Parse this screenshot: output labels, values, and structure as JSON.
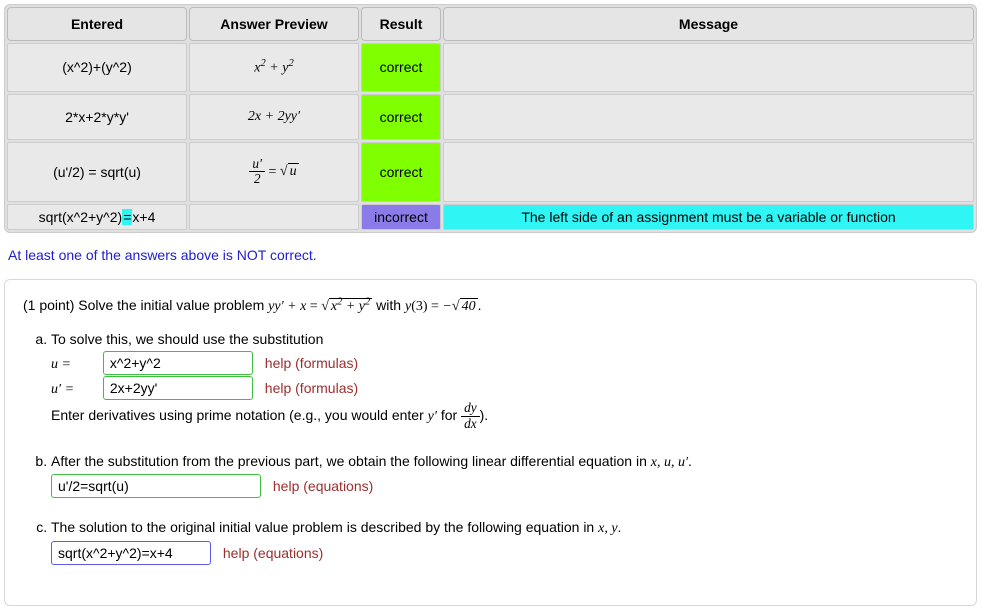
{
  "table": {
    "headers": [
      "Entered",
      "Answer Preview",
      "Result",
      "Message"
    ],
    "rows": [
      {
        "entered": "(x^2)+(y^2)",
        "preview_html": "x<span class='sup'>2</span> + y<span class='sup'>2</span>",
        "result": "correct",
        "result_class": "correct",
        "message": ""
      },
      {
        "entered": "2*x+2*y*y'",
        "preview_html": "2x + 2yy′",
        "result": "correct",
        "result_class": "correct",
        "message": ""
      },
      {
        "entered": "(u'/2) = sqrt(u)",
        "preview_html": "<span class='frac'><span class='num'>u′</span><span class='den'>2</span></span>&nbsp;<span class='mathop'>=</span>&nbsp;<span class='radwrap'><span class='rad'>u</span></span>",
        "result": "correct",
        "result_class": "correct",
        "message": ""
      },
      {
        "entered_html": "sqrt(x^2+y^2)<span class='hl'>=</span>x+4",
        "preview_html": "",
        "result": "incorrect",
        "result_class": "incorrect",
        "message": "The left side of an assignment must be a variable or function",
        "thin": true
      }
    ]
  },
  "notice_text": "At least one of the answers above is NOT correct.",
  "problem": {
    "point_text": "(1 point) Solve the initial value problem ",
    "eq_html": "yy′ + x <span class='mathop'>=</span> <span class='radwrap'><span class='rad'>x<span class='sup'>2</span> + y<span class='sup'>2</span></span></span>",
    "with_text": "  with ",
    "cond_html": "y<span class='mathop'>(3)</span> <span class='mathop'>=</span> −<span class='radwrap'><span class='rad'>40</span></span>",
    "period": ".",
    "a": {
      "text": "To solve this, we should use the substitution",
      "u_label": "u  =",
      "u_value": "x^2+y^2",
      "uprime_label": "u′  =",
      "uprime_value": "2x+2yy'",
      "help": "help (formulas)",
      "deriv_hint_a": "Enter derivatives using prime notation (e.g., you would enter ",
      "deriv_hint_b": "y′",
      "deriv_hint_c": " for ",
      "deriv_hint_d": ").",
      "dydx_num": "dy",
      "dydx_den": "dx"
    },
    "b": {
      "text_a": "After the substitution from the previous part, we obtain the following linear differential equation in ",
      "vars": "x, u, u′",
      "text_b": ".",
      "value": "u'/2=sqrt(u)",
      "help": "help (equations)"
    },
    "c": {
      "text_a": "The solution to the original initial value problem is described by the following equation in ",
      "vars": "x, y",
      "text_b": ".",
      "value": "sqrt(x^2+y^2)=x+4",
      "help": "help (equations)"
    }
  }
}
